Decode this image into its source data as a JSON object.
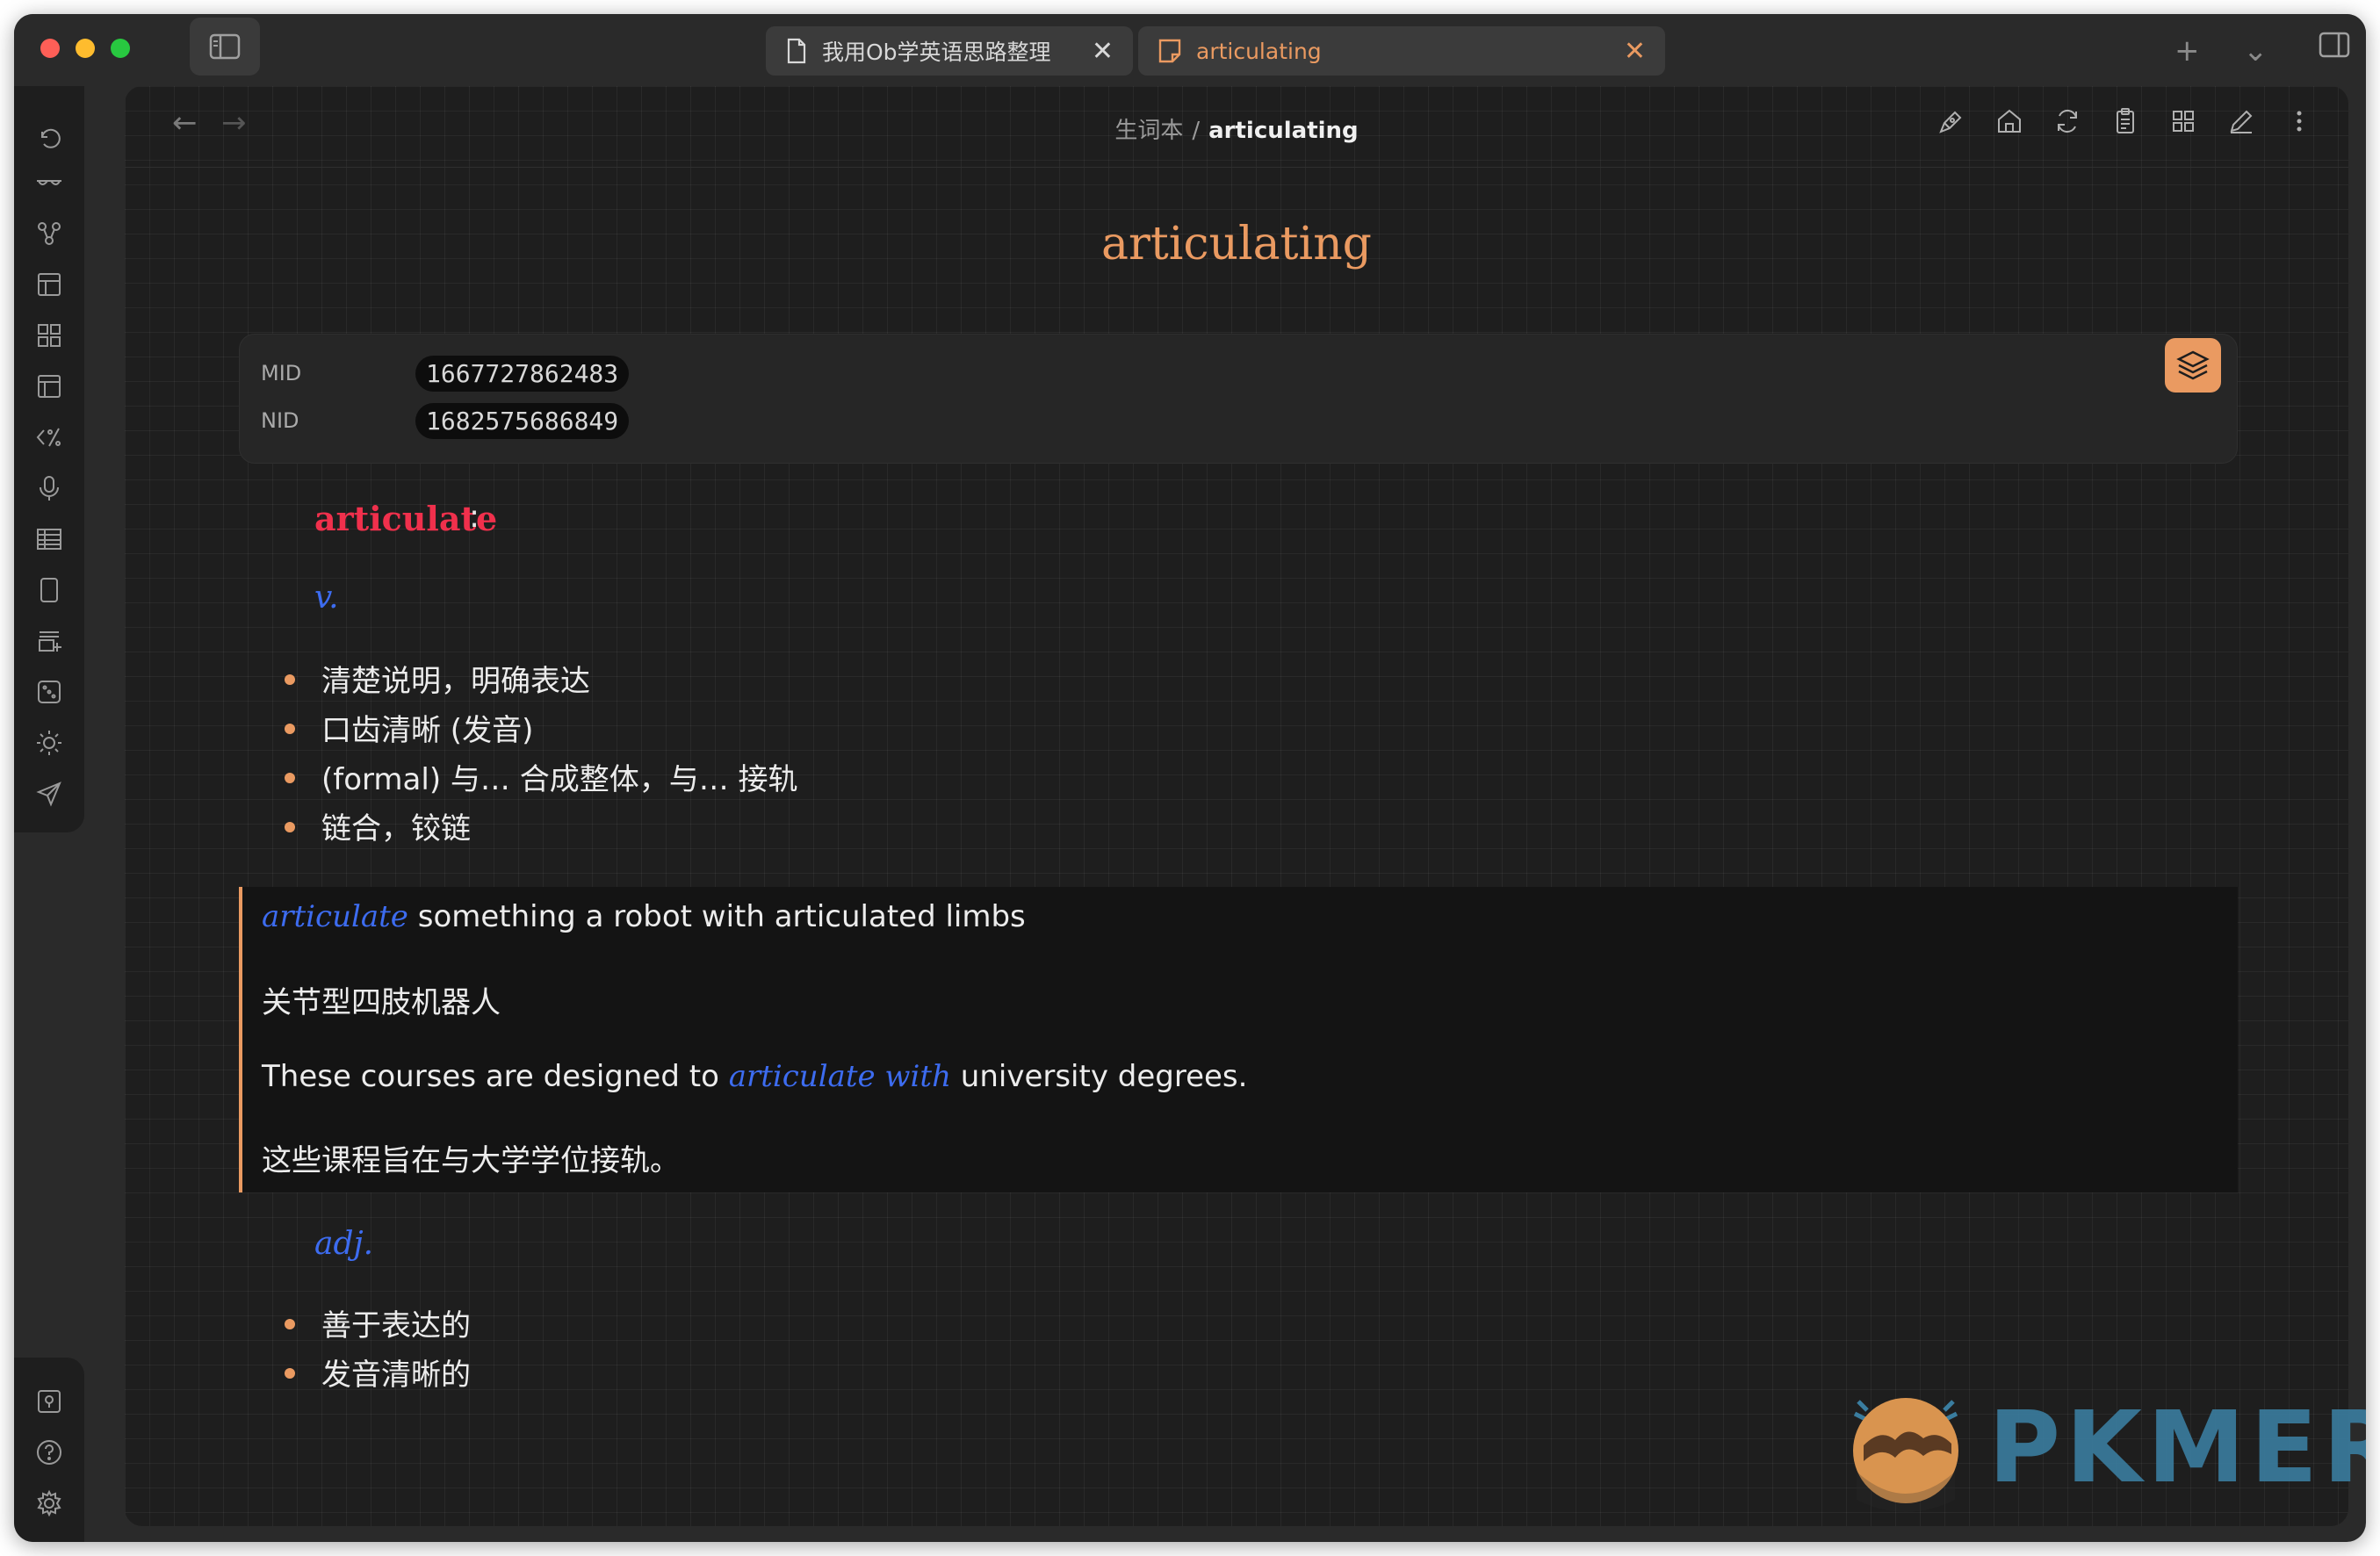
{
  "window": {
    "tabs": [
      {
        "label": "我用Ob学英语思路整理",
        "icon": "file-icon",
        "close": "✕"
      },
      {
        "label": "articulating",
        "icon": "note-icon",
        "close": "✕"
      }
    ],
    "new_tab": "+",
    "tab_list": "⌄"
  },
  "nav": {
    "back": "←",
    "forward": "→"
  },
  "breadcrumb": {
    "parent": "生词本",
    "separator": "/",
    "current": "articulating"
  },
  "note": {
    "title": "articulating",
    "properties": [
      {
        "key": "MID",
        "value": "1667727862483"
      },
      {
        "key": "NID",
        "value": "1682575686849"
      }
    ],
    "headword": "articulate",
    "colon": ":",
    "pos_verb": "v.",
    "verb_senses": [
      "清楚说明，明确表达",
      "口齿清晰 (发音)",
      "(formal) 与… 合成整体，与… 接轨",
      "链合，铰链"
    ],
    "quote": {
      "line1_em": "articulate",
      "line1_rest": " something a robot with articulated limbs",
      "line2": "关节型四肢机器人",
      "line3_pre": "These courses are designed to ",
      "line3_em": "articulate with",
      "line3_post": " university degrees.",
      "line4": "这些课程旨在与大学学位接轨。"
    },
    "pos_adj": "adj.",
    "adj_senses": [
      "善于表达的",
      "发音清晰的"
    ]
  },
  "watermark": {
    "text": "PKMER"
  },
  "colors": {
    "accent": "#ea9a61",
    "headword": "#f0304c",
    "pos": "#3d6cf0",
    "background": "#1e1e1e"
  }
}
